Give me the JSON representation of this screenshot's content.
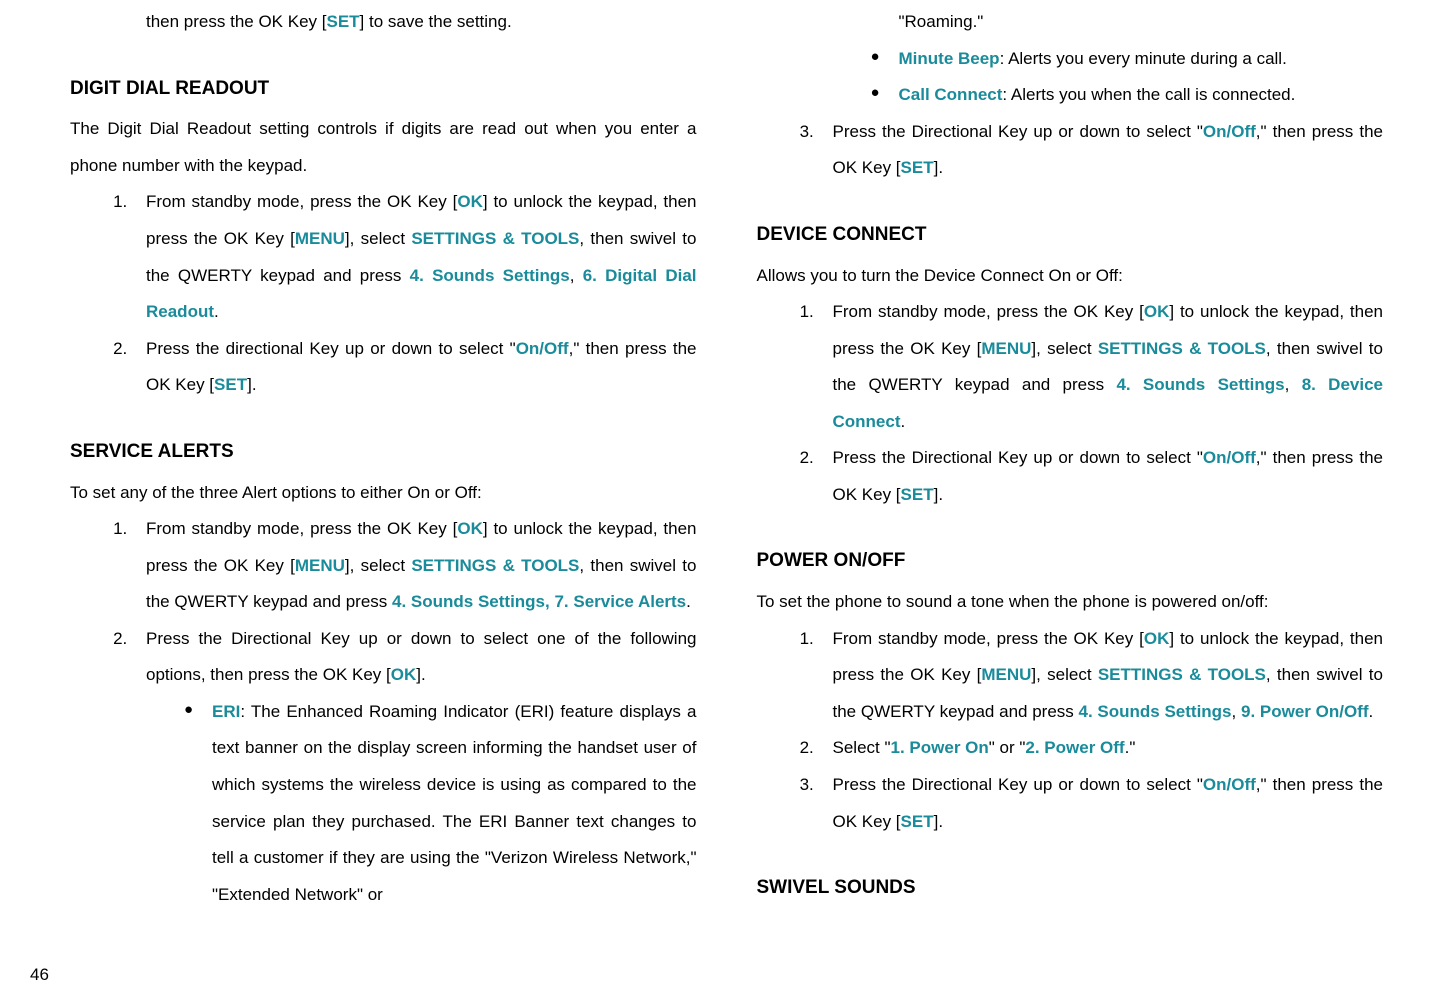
{
  "pageNumber": "46",
  "left": {
    "topPartial": {
      "t1": "then press the OK Key [",
      "k1": "SET",
      "t2": "] to save the setting."
    },
    "digitDial": {
      "heading": "DIGIT DIAL READOUT",
      "intro": "The Digit Dial Readout setting controls if digits are read out when you enter a phone number with the keypad.",
      "s1": {
        "a": "From standby mode, press the OK Key [",
        "ok": "OK",
        "b": "] to unlock the keypad, then press the OK Key [",
        "menu": "MENU",
        "c": "], select ",
        "st": "SETTINGS & TOOLS",
        "d": ", then swivel to the QWERTY keypad and press ",
        "p1": "4. Sounds Settings",
        "e": ", ",
        "p2": "6. Digital Dial Readout",
        "f": "."
      },
      "s2": {
        "a": "Press the directional Key up or down to select \"",
        "onoff": "On/Off",
        "b": ",\" then press the OK Key [",
        "set": "SET",
        "c": "]."
      }
    },
    "serviceAlerts": {
      "heading": "SERVICE ALERTS",
      "intro": "To set any of the three Alert options to either On or Off:",
      "s1": {
        "a": "From standby mode, press the OK Key [",
        "ok": "OK",
        "b": "] to unlock the keypad, then press the OK Key [",
        "menu": "MENU",
        "c": "], select ",
        "st": "SETTINGS & TOOLS",
        "d": ", then swivel to the QWERTY keypad and press ",
        "p1": "4. Sounds Settings, 7. Service Alerts",
        "e": "."
      },
      "s2": {
        "a": "Press the Directional Key up or down to select one of the following options, then press the OK Key [",
        "ok": "OK",
        "b": "]."
      },
      "eri": {
        "label": "ERI",
        "text": ": The Enhanced Roaming Indicator (ERI) feature displays a text banner on the display screen informing the handset user of which systems the wireless device is using as compared to the service plan they purchased. The ERI Banner text changes to tell a customer if they are using the \"Verizon Wireless Network,\" \"Extended Network\" or"
      }
    }
  },
  "right": {
    "roamingCont": "\"Roaming.\"",
    "minuteBeep": {
      "label": "Minute Beep",
      "text": ": Alerts you every minute during a call."
    },
    "callConnect": {
      "label": "Call Connect",
      "text": ": Alerts you when the call is connected."
    },
    "s3": {
      "a": "Press the Directional Key up or down to select \"",
      "onoff": "On/Off",
      "b": ",\" then press the OK Key [",
      "set": "SET",
      "c": "]."
    },
    "deviceConnect": {
      "heading": "DEVICE CONNECT",
      "intro": "Allows you to turn the Device Connect On or Off:",
      "s1": {
        "a": "From standby mode, press the OK Key [",
        "ok": "OK",
        "b": "] to unlock the keypad, then press the OK Key [",
        "menu": "MENU",
        "c": "], select ",
        "st": "SETTINGS & TOOLS",
        "d": ", then swivel to the QWERTY keypad and press ",
        "p1": "4. Sounds Settings",
        "e": ", ",
        "p2": "8. Device Connect",
        "f": "."
      },
      "s2": {
        "a": "Press the Directional Key up or down to select \"",
        "onoff": "On/Off",
        "b": ",\" then press the OK Key [",
        "set": "SET",
        "c": "]."
      }
    },
    "powerOnOff": {
      "heading": "POWER ON/OFF",
      "intro": "To set the phone to sound a tone when the phone is powered on/off:",
      "s1": {
        "a": "From standby mode, press the OK Key [",
        "ok": "OK",
        "b": "] to unlock the keypad, then press the OK Key [",
        "menu": "MENU",
        "c": "], select ",
        "st": "SETTINGS & TOOLS",
        "d": ", then swivel to the QWERTY keypad and press ",
        "p1": "4. Sounds Settings",
        "e": ", ",
        "p2": "9. Power On/Off",
        "f": "."
      },
      "s2": {
        "a": "Select \"",
        "p1": "1. Power On",
        "b": "\" or \"",
        "p2": "2. Power Off",
        "c": ".\""
      },
      "s3": {
        "a": "Press the Directional Key up or down to select \"",
        "onoff": "On/Off",
        "b": ",\" then press the OK Key [",
        "set": "SET",
        "c": "]."
      }
    },
    "swivel": {
      "heading": "SWIVEL SOUNDS"
    }
  }
}
